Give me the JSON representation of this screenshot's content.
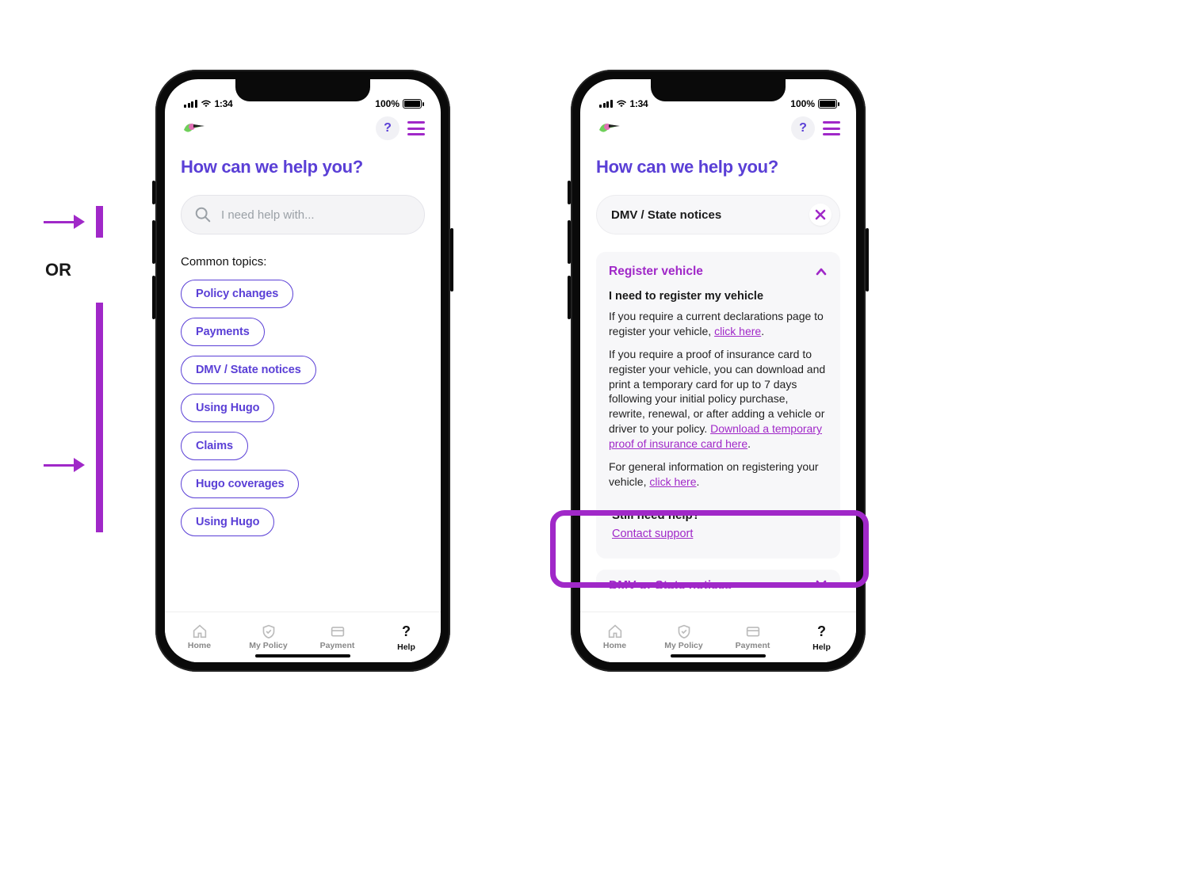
{
  "annotations": {
    "or_label": "OR"
  },
  "status_bar": {
    "time": "1:34",
    "battery_text": "100%"
  },
  "header": {
    "help_glyph": "?",
    "menu_label": "menu"
  },
  "page": {
    "title": "How can we help you?"
  },
  "search": {
    "placeholder": "I need help with...",
    "value": "DMV / State notices",
    "close_glyph": "✕"
  },
  "left_screen": {
    "common_label": "Common topics:",
    "chips": [
      "Policy changes",
      "Payments",
      "DMV / State notices",
      "Using Hugo",
      "Claims",
      "Hugo coverages",
      "Using Hugo"
    ]
  },
  "right_screen": {
    "card_title": "Register vehicle",
    "subheading": "I need to register my vehicle",
    "p1_a": "If you require a current declarations page to register your vehicle, ",
    "p1_link": "click here",
    "p1_b": ".",
    "p2_a": "If you require a proof of insurance card to register your vehicle, you can download and print a temporary card for up to 7 days following your initial policy purchase, rewrite, renewal, or after adding a vehicle or driver to your policy. ",
    "p2_link": "Download a temporary proof of insurance card here",
    "p2_b": ".",
    "p3_a": "For general information on registering your vehicle, ",
    "p3_link": "click here",
    "p3_b": ".",
    "still_help_title": "Still need help?",
    "contact_link": "Contact support",
    "peek_title": "DMV or State notices"
  },
  "bottom_nav": {
    "home": "Home",
    "policy": "My Policy",
    "payment": "Payment",
    "help": "Help",
    "help_glyph": "?"
  }
}
